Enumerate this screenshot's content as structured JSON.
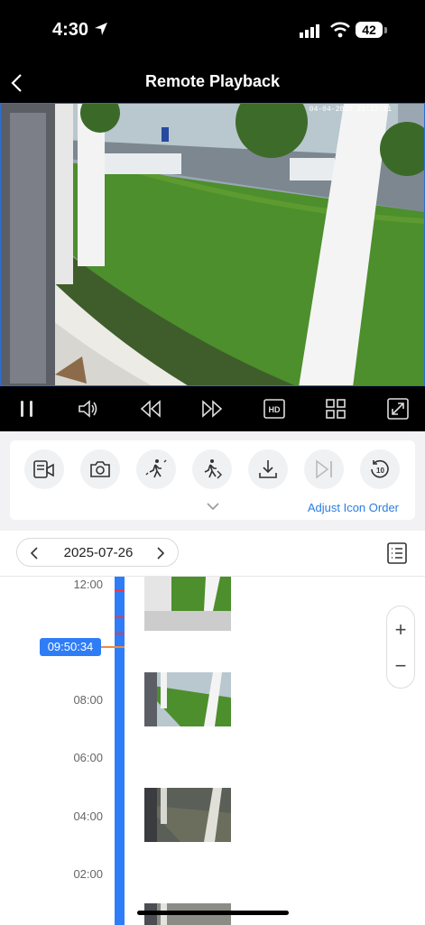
{
  "status_bar": {
    "time": "4:30",
    "battery": "42"
  },
  "nav": {
    "title": "Remote Playback"
  },
  "video": {
    "osd_timestamp": "04-04-2025 21:22:31"
  },
  "toolbar": {
    "adjust_label": "Adjust Icon Order"
  },
  "date_bar": {
    "date": "2025-07-26"
  },
  "timeline": {
    "ticks": [
      "12:00",
      "08:00",
      "06:00",
      "04:00",
      "02:00"
    ],
    "cursor_time": "09:50:34"
  },
  "zoom": {
    "plus": "+",
    "minus": "−"
  },
  "colors": {
    "accent": "#2f7df6",
    "event_mark": "#e83b4a",
    "background": "#000000"
  }
}
